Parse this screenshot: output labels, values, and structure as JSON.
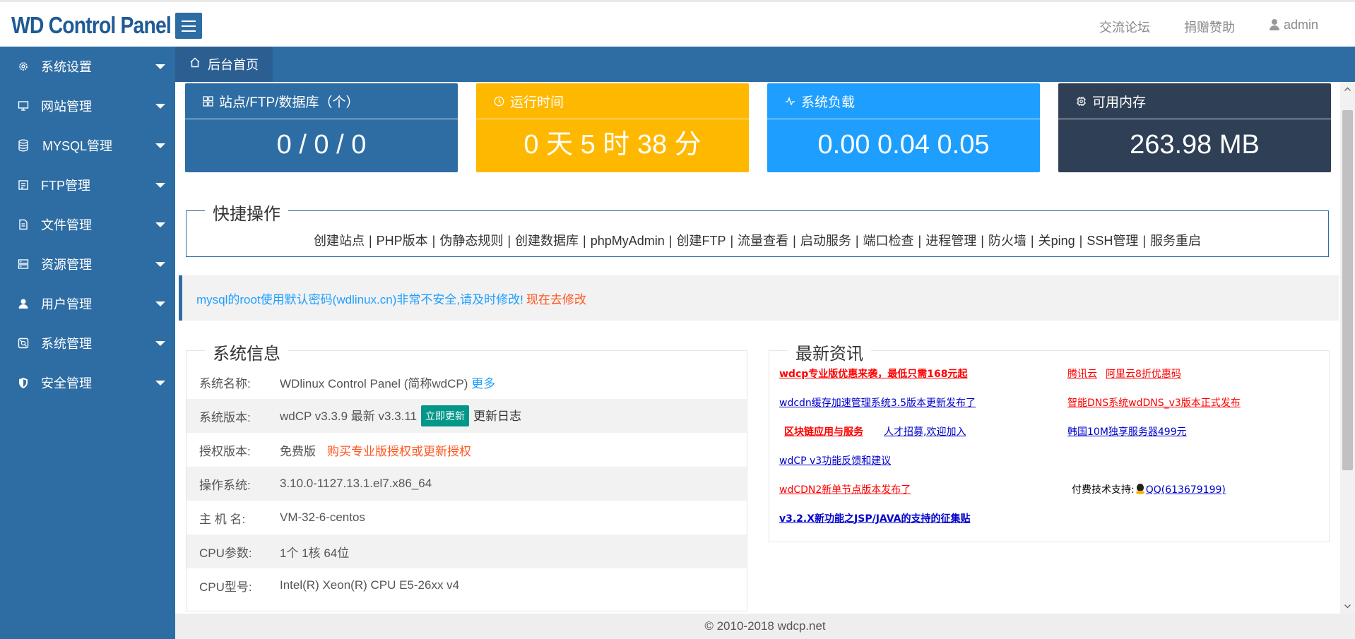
{
  "header": {
    "logo": "WD Control Panel",
    "links": {
      "forum": "交流论坛",
      "donate": "捐赠赞助",
      "user": "admin"
    }
  },
  "sidebar": {
    "items": [
      {
        "label": "系统设置",
        "icon": "gear-icon"
      },
      {
        "label": "网站管理",
        "icon": "monitor-icon"
      },
      {
        "label": "MYSQL管理",
        "icon": "database-icon"
      },
      {
        "label": "FTP管理",
        "icon": "ftp-icon"
      },
      {
        "label": "文件管理",
        "icon": "file-icon"
      },
      {
        "label": "资源管理",
        "icon": "server-icon"
      },
      {
        "label": "用户管理",
        "icon": "user-icon"
      },
      {
        "label": "系统管理",
        "icon": "system-icon"
      },
      {
        "label": "安全管理",
        "icon": "shield-icon"
      }
    ]
  },
  "tabs": {
    "home": "后台首页"
  },
  "cards": {
    "sites": {
      "title": "站点/FTP/数据库（个）",
      "value": "0 / 0 / 0"
    },
    "uptime": {
      "title": "运行时间",
      "value": "0 天 5 时 38 分"
    },
    "load": {
      "title": "系统负载",
      "value": "0.00 0.04 0.05"
    },
    "memory": {
      "title": "可用内存",
      "value": "263.98 MB"
    }
  },
  "quick": {
    "title": "快捷操作",
    "links": [
      "创建站点",
      "PHP版本",
      "伪静态规则",
      "创建数据库",
      "phpMyAdmin",
      "创建FTP",
      "流量查看",
      "启动服务",
      "端口检查",
      "进程管理",
      "防火墙",
      "关ping",
      "SSH管理",
      "服务重启"
    ],
    "separator": "|"
  },
  "notice": {
    "text": "mysql的root使用默认密码(wdlinux.cn)非常不安全,请及时修改!",
    "link": "现在去修改"
  },
  "sysinfo": {
    "title": "系统信息",
    "name_key": "系统名称:",
    "name_value": "WDlinux Control Panel (简称wdCP)",
    "name_more": "更多",
    "version_key": "系统版本:",
    "version_value": "wdCP v3.3.9 最新 v3.3.11",
    "version_update": "立即更新",
    "version_log": "更新日志",
    "license_key": "授权版本:",
    "license_value": "免费版",
    "license_link": "购买专业版授权或更新授权",
    "os_key": "操作系统:",
    "os_value": "3.10.0-1127.13.1.el7.x86_64",
    "host_key": "主 机 名:",
    "host_value": "VM-32-6-centos",
    "cpu_key": "CPU参数:",
    "cpu_value": "1个 1核 64位",
    "cpumodel_key": "CPU型号:",
    "cpumodel_value": "Intel(R) Xeon(R) CPU E5-26xx v4"
  },
  "news": {
    "title": "最新资讯",
    "items": {
      "promo": "wdcp专业版优惠来袭，最低只需168元起",
      "tencent": "腾讯云",
      "aliyun": "阿里云8折优惠码",
      "wdcdn": "wdcdn缓存加速管理系统3.5版本更新发布了",
      "dns": "智能DNS系统wdDNS_v3版本正式发布",
      "blockchain": "区块链应用与服务",
      "hiring": "人才招募,欢迎加入",
      "korea": "韩国10M独享服务器499元",
      "feedback": "wdCP v3功能反馈和建议",
      "cdn2": "wdCDN2新单节点版本发布了",
      "support_label": "付费技术支持:",
      "support_qq": "QQ(613679199)",
      "jsp": "v3.2.X新功能之JSP/JAVA的支持的征集贴"
    }
  },
  "footer": {
    "text": "© 2010-2018 wdcp.net"
  }
}
